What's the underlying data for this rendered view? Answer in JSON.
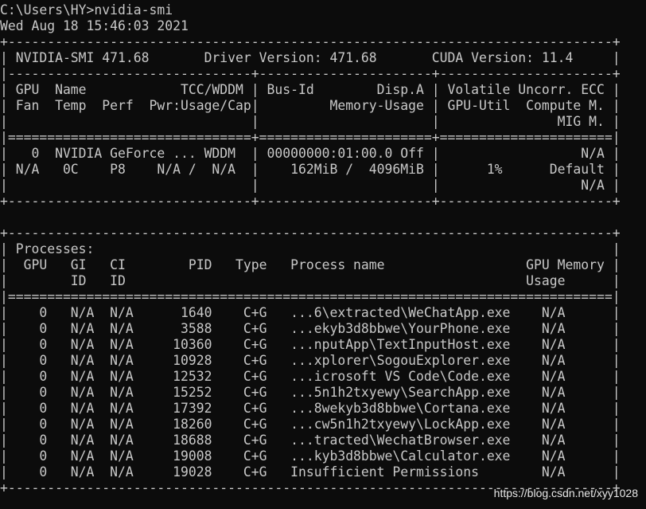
{
  "terminal": {
    "text_color": "#c8c8c8",
    "background": "#0c0c0c",
    "lines": [
      "C:\\Users\\HY>nvidia-smi",
      "Wed Aug 18 15:46:03 2021",
      "+-----------------------------------------------------------------------------+",
      "| NVIDIA-SMI 471.68       Driver Version: 471.68       CUDA Version: 11.4     |",
      "|-------------------------------+----------------------+----------------------+",
      "| GPU  Name            TCC/WDDM | Bus-Id        Disp.A | Volatile Uncorr. ECC |",
      "| Fan  Temp  Perf  Pwr:Usage/Cap|         Memory-Usage | GPU-Util  Compute M. |",
      "|                               |                      |               MIG M. |",
      "|===============================+======================+======================|",
      "|   0  NVIDIA GeForce ... WDDM  | 00000000:01:00.0 Off |                  N/A |",
      "| N/A   0C    P8    N/A /  N/A  |    162MiB /  4096MiB |      1%      Default |",
      "|                               |                      |                  N/A |",
      "+-------------------------------+----------------------+----------------------+",
      "",
      "+-----------------------------------------------------------------------------+",
      "| Processes:                                                                  |",
      "|  GPU   GI   CI        PID   Type   Process name                  GPU Memory |",
      "|        ID   ID                                                   Usage      |",
      "|=============================================================================|",
      "|    0   N/A  N/A      1640    C+G   ...6\\extracted\\WeChatApp.exe    N/A      |",
      "|    0   N/A  N/A      3588    C+G   ...ekyb3d8bbwe\\YourPhone.exe    N/A      |",
      "|    0   N/A  N/A     10360    C+G   ...nputApp\\TextInputHost.exe    N/A      |",
      "|    0   N/A  N/A     10928    C+G   ...xplorer\\SogouExplorer.exe    N/A      |",
      "|    0   N/A  N/A     12532    C+G   ...icrosoft VS Code\\Code.exe    N/A      |",
      "|    0   N/A  N/A     15252    C+G   ...5n1h2txyewy\\SearchApp.exe    N/A      |",
      "|    0   N/A  N/A     17392    C+G   ...8wekyb3d8bbwe\\Cortana.exe    N/A      |",
      "|    0   N/A  N/A     18260    C+G   ...cw5n1h2txyewy\\LockApp.exe    N/A      |",
      "|    0   N/A  N/A     18688    C+G   ...tracted\\WechatBrowser.exe    N/A      |",
      "|    0   N/A  N/A     19008    C+G   ...kyb3d8bbwe\\Calculator.exe    N/A      |",
      "|    0   N/A  N/A     19028    C+G   Insufficient Permissions        N/A      |",
      "+-----------------------------------------------------------------------------+"
    ]
  },
  "watermark": "https://blog.csdn.net/xyy1028"
}
